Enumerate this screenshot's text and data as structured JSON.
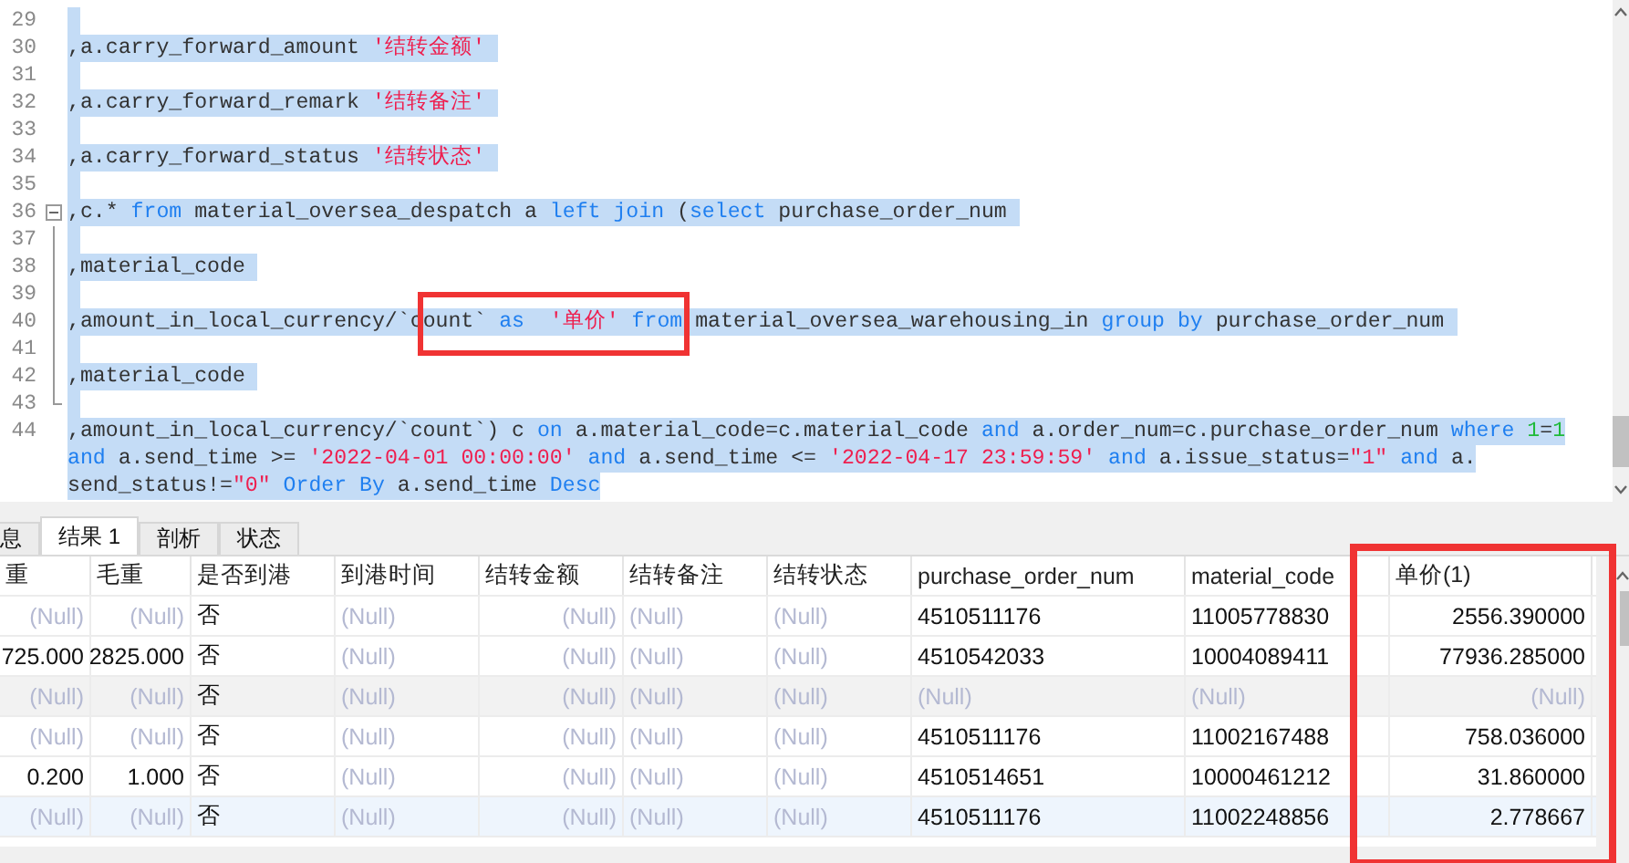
{
  "editor": {
    "lines": [
      {
        "number": "29",
        "kind": "plain"
      },
      {
        "number": "30",
        "kind": "plain",
        "rows": [
          {
            "tokens": [
              {
                "kind": "plain",
                "t": ",a.carry_forward_amount "
              },
              {
                "kind": "str",
                "t": "'结转金额'"
              }
            ]
          }
        ]
      },
      {
        "number": "31",
        "kind": "plain"
      },
      {
        "number": "32",
        "kind": "plain",
        "rows": [
          {
            "tokens": [
              {
                "kind": "plain",
                "t": ",a.carry_forward_remark "
              },
              {
                "kind": "str",
                "t": "'结转备注'"
              }
            ]
          }
        ]
      },
      {
        "number": "33",
        "kind": "plain"
      },
      {
        "number": "34",
        "kind": "plain",
        "rows": [
          {
            "tokens": [
              {
                "kind": "plain",
                "t": ",a.carry_forward_status "
              },
              {
                "kind": "str",
                "t": "'结转状态'"
              }
            ]
          }
        ]
      },
      {
        "number": "35",
        "kind": "plain"
      },
      {
        "number": "36",
        "kind": "fold_start",
        "rows": [
          {
            "tokens": [
              {
                "kind": "plain",
                "t": ",c.* "
              },
              {
                "kind": "kw",
                "t": "from"
              },
              {
                "kind": "plain",
                "t": " material_oversea_despatch a "
              },
              {
                "kind": "kw",
                "t": "left join"
              },
              {
                "kind": "plain",
                "t": " ("
              },
              {
                "kind": "kw",
                "t": "select"
              },
              {
                "kind": "plain",
                "t": " purchase_order_num"
              }
            ]
          }
        ]
      },
      {
        "number": "37",
        "kind": "fold_inside"
      },
      {
        "number": "38",
        "kind": "fold_inside",
        "rows": [
          {
            "tokens": [
              {
                "kind": "plain",
                "t": ",material_code"
              }
            ]
          }
        ]
      },
      {
        "number": "39",
        "kind": "fold_inside"
      },
      {
        "number": "40",
        "kind": "fold_inside",
        "rows": [
          {
            "tokens": [
              {
                "kind": "plain",
                "t": ",amount_in_local_currency/`c"
              },
              {
                "kind": "plain",
                "t": "ount` ",
                "boxed": true
              },
              {
                "kind": "kw",
                "t": "as",
                "boxed": true
              },
              {
                "kind": "str",
                "t": "  '单价'",
                "boxed": true
              },
              {
                "kind": "kw",
                "t": " from",
                "boxed": true
              },
              {
                "kind": "plain",
                "t": " material_oversea_warehousing_in "
              },
              {
                "kind": "kw",
                "t": "group by"
              },
              {
                "kind": "plain",
                "t": " purchase_order_num"
              }
            ]
          }
        ]
      },
      {
        "number": "41",
        "kind": "fold_inside"
      },
      {
        "number": "42",
        "kind": "fold_inside",
        "rows": [
          {
            "tokens": [
              {
                "kind": "plain",
                "t": ",material_code"
              }
            ]
          }
        ]
      },
      {
        "number": "43",
        "kind": "fold_end"
      },
      {
        "number": "44",
        "kind": "plain",
        "rows": [
          {
            "tokens": [
              {
                "kind": "plain",
                "t": ",amount_in_local_currency/`count`) c "
              },
              {
                "kind": "kw",
                "t": "on"
              },
              {
                "kind": "plain",
                "t": " a.material_code=c.material_code "
              },
              {
                "kind": "kw",
                "t": "and"
              },
              {
                "kind": "plain",
                "t": " a.order_num=c.purchase_order_num "
              },
              {
                "kind": "kw",
                "t": "where"
              },
              {
                "kind": "num",
                "t": " 1"
              },
              {
                "kind": "plain",
                "t": "="
              },
              {
                "kind": "num",
                "t": "1"
              }
            ]
          },
          {
            "tokens": [
              {
                "kind": "kw",
                "t": "and"
              },
              {
                "kind": "plain",
                "t": " a.send_time >= "
              },
              {
                "kind": "str",
                "t": "'2022-04-01 00:00:00'"
              },
              {
                "kind": "kw",
                "t": " and"
              },
              {
                "kind": "plain",
                "t": " a.send_time <= "
              },
              {
                "kind": "str",
                "t": "'2022-04-17 23:59:59'"
              },
              {
                "kind": "kw",
                "t": " and"
              },
              {
                "kind": "plain",
                "t": " a.issue_status="
              },
              {
                "kind": "str",
                "t": "\"1\""
              },
              {
                "kind": "kw",
                "t": " and"
              },
              {
                "kind": "plain",
                "t": " a."
              }
            ]
          },
          {
            "tokens": [
              {
                "kind": "plain",
                "t": "send_status!="
              },
              {
                "kind": "str",
                "t": "\"0\""
              },
              {
                "kind": "kw",
                "t": " Order By"
              },
              {
                "kind": "plain",
                "t": " a.send_time "
              },
              {
                "kind": "kw",
                "t": "Desc"
              }
            ]
          }
        ]
      }
    ]
  },
  "tabs": [
    {
      "label": "息",
      "selected": false
    },
    {
      "label": "结果 1",
      "selected": true
    },
    {
      "label": "剖析",
      "selected": false
    },
    {
      "label": "状态",
      "selected": false
    }
  ],
  "table": {
    "columns": [
      {
        "label": "重",
        "kind": "number"
      },
      {
        "label": "毛重",
        "kind": "number"
      },
      {
        "label": "是否到港",
        "kind": "text"
      },
      {
        "label": "到港时间",
        "kind": "text"
      },
      {
        "label": "结转金额",
        "kind": "number"
      },
      {
        "label": "结转备注",
        "kind": "text"
      },
      {
        "label": "结转状态",
        "kind": "text"
      },
      {
        "label": "purchase_order_num",
        "kind": "text"
      },
      {
        "label": "material_code",
        "kind": "text"
      },
      {
        "label": "单价(1)",
        "kind": "number",
        "boxed": true
      }
    ],
    "rows": [
      {
        "hovered": false,
        "selected": false,
        "cells": [
          {
            "t": "(Null)",
            "null": true
          },
          {
            "t": "(Null)",
            "null": true
          },
          {
            "t": "否",
            "null": false
          },
          {
            "t": "(Null)",
            "null": true
          },
          {
            "t": "(Null)",
            "null": true
          },
          {
            "t": "(Null)",
            "null": true
          },
          {
            "t": "(Null)",
            "null": true
          },
          {
            "t": "4510511176",
            "null": false
          },
          {
            "t": "11005778830",
            "null": false
          },
          {
            "t": "2556.390000",
            "null": false
          }
        ]
      },
      {
        "hovered": false,
        "selected": false,
        "cells": [
          {
            "t": "725.000",
            "null": false
          },
          {
            "t": "2825.000",
            "null": false
          },
          {
            "t": "否",
            "null": false
          },
          {
            "t": "(Null)",
            "null": true
          },
          {
            "t": "(Null)",
            "null": true
          },
          {
            "t": "(Null)",
            "null": true
          },
          {
            "t": "(Null)",
            "null": true
          },
          {
            "t": "4510542033",
            "null": false
          },
          {
            "t": "10004089411",
            "null": false
          },
          {
            "t": "77936.285000",
            "null": false
          }
        ]
      },
      {
        "hovered": true,
        "selected": false,
        "cells": [
          {
            "t": "(Null)",
            "null": true
          },
          {
            "t": "(Null)",
            "null": true
          },
          {
            "t": "否",
            "null": false
          },
          {
            "t": "(Null)",
            "null": true
          },
          {
            "t": "(Null)",
            "null": true
          },
          {
            "t": "(Null)",
            "null": true
          },
          {
            "t": "(Null)",
            "null": true
          },
          {
            "t": "(Null)",
            "null": true
          },
          {
            "t": "(Null)",
            "null": true
          },
          {
            "t": "(Null)",
            "null": true
          }
        ]
      },
      {
        "hovered": false,
        "selected": false,
        "cells": [
          {
            "t": "(Null)",
            "null": true
          },
          {
            "t": "(Null)",
            "null": true
          },
          {
            "t": "否",
            "null": false
          },
          {
            "t": "(Null)",
            "null": true
          },
          {
            "t": "(Null)",
            "null": true
          },
          {
            "t": "(Null)",
            "null": true
          },
          {
            "t": "(Null)",
            "null": true
          },
          {
            "t": "4510511176",
            "null": false
          },
          {
            "t": "11002167488",
            "null": false
          },
          {
            "t": "758.036000",
            "null": false
          }
        ]
      },
      {
        "hovered": false,
        "selected": false,
        "cells": [
          {
            "t": "0.200",
            "null": false
          },
          {
            "t": "1.000",
            "null": false
          },
          {
            "t": "否",
            "null": false
          },
          {
            "t": "(Null)",
            "null": true
          },
          {
            "t": "(Null)",
            "null": true
          },
          {
            "t": "(Null)",
            "null": true
          },
          {
            "t": "(Null)",
            "null": true
          },
          {
            "t": "4510514651",
            "null": false
          },
          {
            "t": "10000461212",
            "null": false
          },
          {
            "t": "31.860000",
            "null": false
          }
        ]
      },
      {
        "hovered": false,
        "selected": true,
        "cells": [
          {
            "t": "(Null)",
            "null": true
          },
          {
            "t": "(Null)",
            "null": true
          },
          {
            "t": "否",
            "null": false
          },
          {
            "t": "(Null)",
            "null": true
          },
          {
            "t": "(Null)",
            "null": true
          },
          {
            "t": "(Null)",
            "null": true
          },
          {
            "t": "(Null)",
            "null": true
          },
          {
            "t": "4510511176",
            "null": false
          },
          {
            "t": "11002248856",
            "null": false
          },
          {
            "t": "2.778667",
            "null": false
          }
        ]
      }
    ]
  }
}
